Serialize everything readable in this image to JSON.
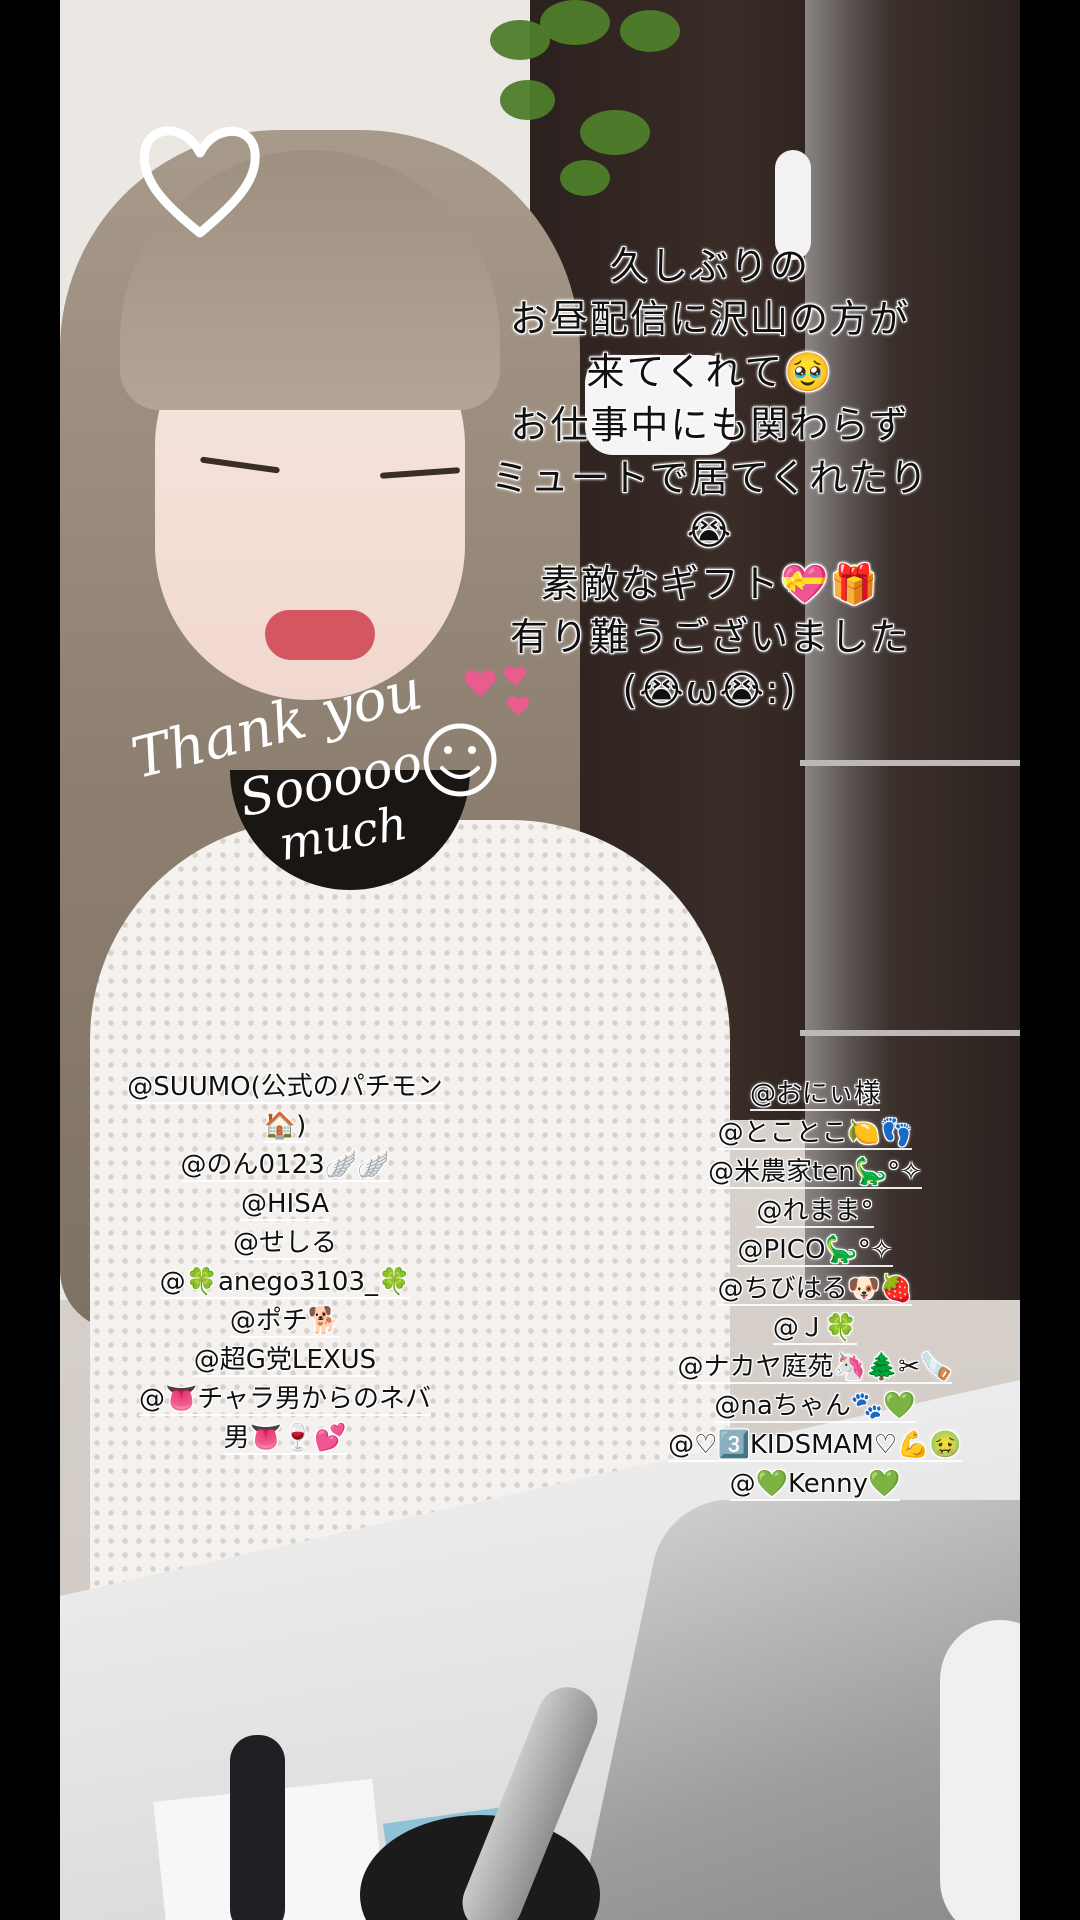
{
  "message": {
    "lines": [
      "久しぶりの",
      "お昼配信に沢山の方が",
      "来てくれて🥹",
      "お仕事中にも関わらず",
      "ミュートで居てくれたり",
      "😭",
      "素敵なギフト💝🎁",
      "有り難うございました",
      "(😭ω😭:)"
    ]
  },
  "stickers": {
    "thank_you": [
      "Thank you",
      "Sooooo",
      "much"
    ]
  },
  "mentions_left": [
    "@SUUMO(公式のパチモン",
    "🏠)",
    "@のん0123🪽🪽",
    "@HISA",
    "@せしる",
    "@🍀anego3103_🍀",
    "@ポチ🐕",
    "@超G党LEXUS",
    "@👅チャラ男からのネバ",
    "男👅🍷💕"
  ],
  "mentions_right": [
    "@おにぃ様",
    "@とことこ🍋👣",
    "@米農家ten🦕°✧",
    "@れまま°",
    "@PICO🦕°✧",
    "@ちびはる🐶🍓",
    "@Ｊ🍀",
    "@ナカヤ庭苑🦄🌲✂🪚",
    "@naちゃん🐾💚",
    "@♡3️⃣KIDSMAM♡💪🤢",
    "@💚Kenny💚"
  ],
  "colors": {
    "letterbox": "#000000",
    "text": "#111111",
    "text_outline": "#ffffff",
    "sticker": "#ffffff",
    "accent_heart": "#e95c8e"
  },
  "icons": [
    "heart-outline-icon",
    "smiley-icon",
    "small-hearts-icon"
  ]
}
